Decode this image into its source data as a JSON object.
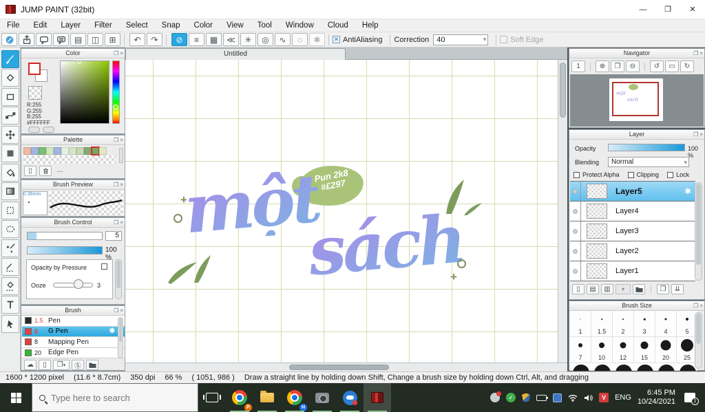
{
  "window": {
    "title": "JUMP PAINT (32bit)"
  },
  "icons": {
    "popout": "❐",
    "close": "×",
    "minimize": "—",
    "restore": "❐",
    "close_win": "✕",
    "undo": "↶",
    "redo": "↷",
    "snap_off": "⊘",
    "snap_parallel": "≡",
    "snap_grid": "▦",
    "snap_vanish": "≪",
    "snap_radial": "✳",
    "snap_concentric": "◎",
    "snap_curve": "∿",
    "snap_ellipse": "◌",
    "snap_settings": "✱",
    "doc": "▤",
    "layout": "◫",
    "pixelgrid": "⊞",
    "nav_zoom_actual": "1",
    "nav_zoom_in": "⊕",
    "nav_fit": "❐",
    "nav_zoom_out": "⊖",
    "nav_rotate_left": "↺",
    "nav_rotate_reset": "▭",
    "nav_rotate_right": "↻",
    "gear": "✱",
    "dropdown_arrow": "▾",
    "check_x": "✕",
    "cloud": "☁",
    "new_page": "▯",
    "copy": "❐",
    "s_badge": "Ⓢ",
    "merge": "⇊",
    "layer_new": "▯",
    "layer_halftone": "▤",
    "layer_1bit": "▥"
  },
  "menu": {
    "items": [
      "File",
      "Edit",
      "Layer",
      "Filter",
      "Select",
      "Snap",
      "Color",
      "View",
      "Tool",
      "Window",
      "Cloud",
      "Help"
    ]
  },
  "toolbar": {
    "antialiasing": "AntiAliasing",
    "correction": "Correction",
    "correction_value": "40",
    "soft_edge": "Soft Edge"
  },
  "color_panel": {
    "title": "Color",
    "r_label": "R:255",
    "g_label": "G:255",
    "b_label": "B:255",
    "hex_label": "#FFFFFF"
  },
  "palette_panel": {
    "title": "Palette",
    "divider": "---",
    "selected_index": 9,
    "swatches": [
      "#f0b9a3",
      "#9fb6e3",
      "#7cbf77",
      "#cfe9c0",
      "#a3b5e6",
      "#e7f0e2",
      "#d4e6c6",
      "#c4d9b4",
      "#86a876",
      "#74a763",
      "#dfe8c6"
    ]
  },
  "brush_preview_panel": {
    "title": "Brush Preview",
    "stroke_size": "0.36mm"
  },
  "brush_control_panel": {
    "title": "Brush Control",
    "size_value": "5",
    "opacity_value": "100 %",
    "pressure_label": "Opacity by Pressure",
    "ooze_label": "Ooze",
    "ooze_value": "3"
  },
  "brush_panel": {
    "title": "Brush",
    "brushes": [
      {
        "size": "1.5",
        "name": "Pen",
        "color": "#2b2b2b"
      },
      {
        "size": "5",
        "name": "G Pen",
        "color": "#e0433e"
      },
      {
        "size": "8",
        "name": "Mapping Pen",
        "color": "#e0433e"
      },
      {
        "size": "20",
        "name": "Edge Pen",
        "color": "#2fbc2f"
      }
    ]
  },
  "canvas": {
    "tab_title": "Untitled",
    "artwork": {
      "word1": "một",
      "word2": "sách",
      "badge_line1": "Pun 2k8",
      "badge_line2": "#£297"
    }
  },
  "navigator_panel": {
    "title": "Navigator"
  },
  "layer_panel": {
    "title": "Layer",
    "opacity_label": "Opacity",
    "opacity_value": "100 %",
    "blending_label": "Blending",
    "blending_value": "Normal",
    "protect_alpha_label": "Protect Alpha",
    "clipping_label": "Clipping",
    "lock_label": "Lock",
    "layers": [
      "Layer5",
      "Layer4",
      "Layer3",
      "Layer2",
      "Layer1"
    ]
  },
  "brush_size_panel": {
    "title": "Brush Size",
    "sizes": [
      "1",
      "1.5",
      "2",
      "3",
      "4",
      "5",
      "7",
      "10",
      "12",
      "15",
      "20",
      "25"
    ]
  },
  "status_bar": {
    "size": "1600 * 1200 pixel",
    "dimensions": "(11.6 * 8.7cm)",
    "dpi": "350 dpi",
    "zoom": "66 %",
    "cursor": "( 1051, 986 )",
    "hint": "Draw a straight line by holding down Shift, Change a brush size by holding down Ctrl, Alt, and dragging"
  },
  "taskbar": {
    "search_placeholder": "Type here to search",
    "chrome_badge_1": "P",
    "chrome_badge_2": "H",
    "language": "ENG",
    "time": "6:45 PM",
    "date": "10/24/2021",
    "notification_count": "1"
  },
  "colors": {
    "accent_blue": "#2ba7e0",
    "taskbar_green": "#232c23",
    "script_purple": "#a292e8",
    "leaf_green": "#7d9c5c",
    "grid_olive": "#d8d9b2"
  }
}
